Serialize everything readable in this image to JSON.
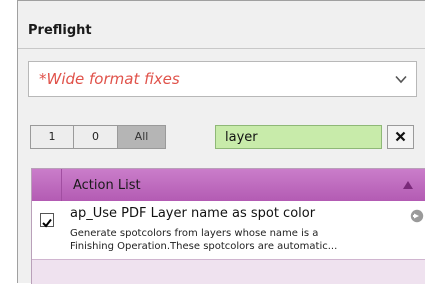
{
  "panel": {
    "title": "Preflight",
    "profile_dropdown": {
      "selected": "*Wide format fixes"
    },
    "filter_buttons": [
      {
        "label": "1"
      },
      {
        "label": "0"
      },
      {
        "label": "All",
        "selected": true
      }
    ],
    "search": {
      "value": "layer"
    },
    "clear_icon": "close-icon"
  },
  "action_list": {
    "header": "Action List",
    "sort_icon": "sort-up-icon",
    "items": [
      {
        "checked": true,
        "title": "ap_Use PDF Layer name as spot color",
        "description": "Generate spotcolors from layers whose name is a\nFinishing Operation.These spotcolors are automatic...",
        "action_icon": "arrow-right-circle-icon"
      }
    ]
  },
  "colors": {
    "header_accent": "#b35bb3",
    "search_background": "#c8ebaa",
    "profile_text": "#e0524a"
  }
}
